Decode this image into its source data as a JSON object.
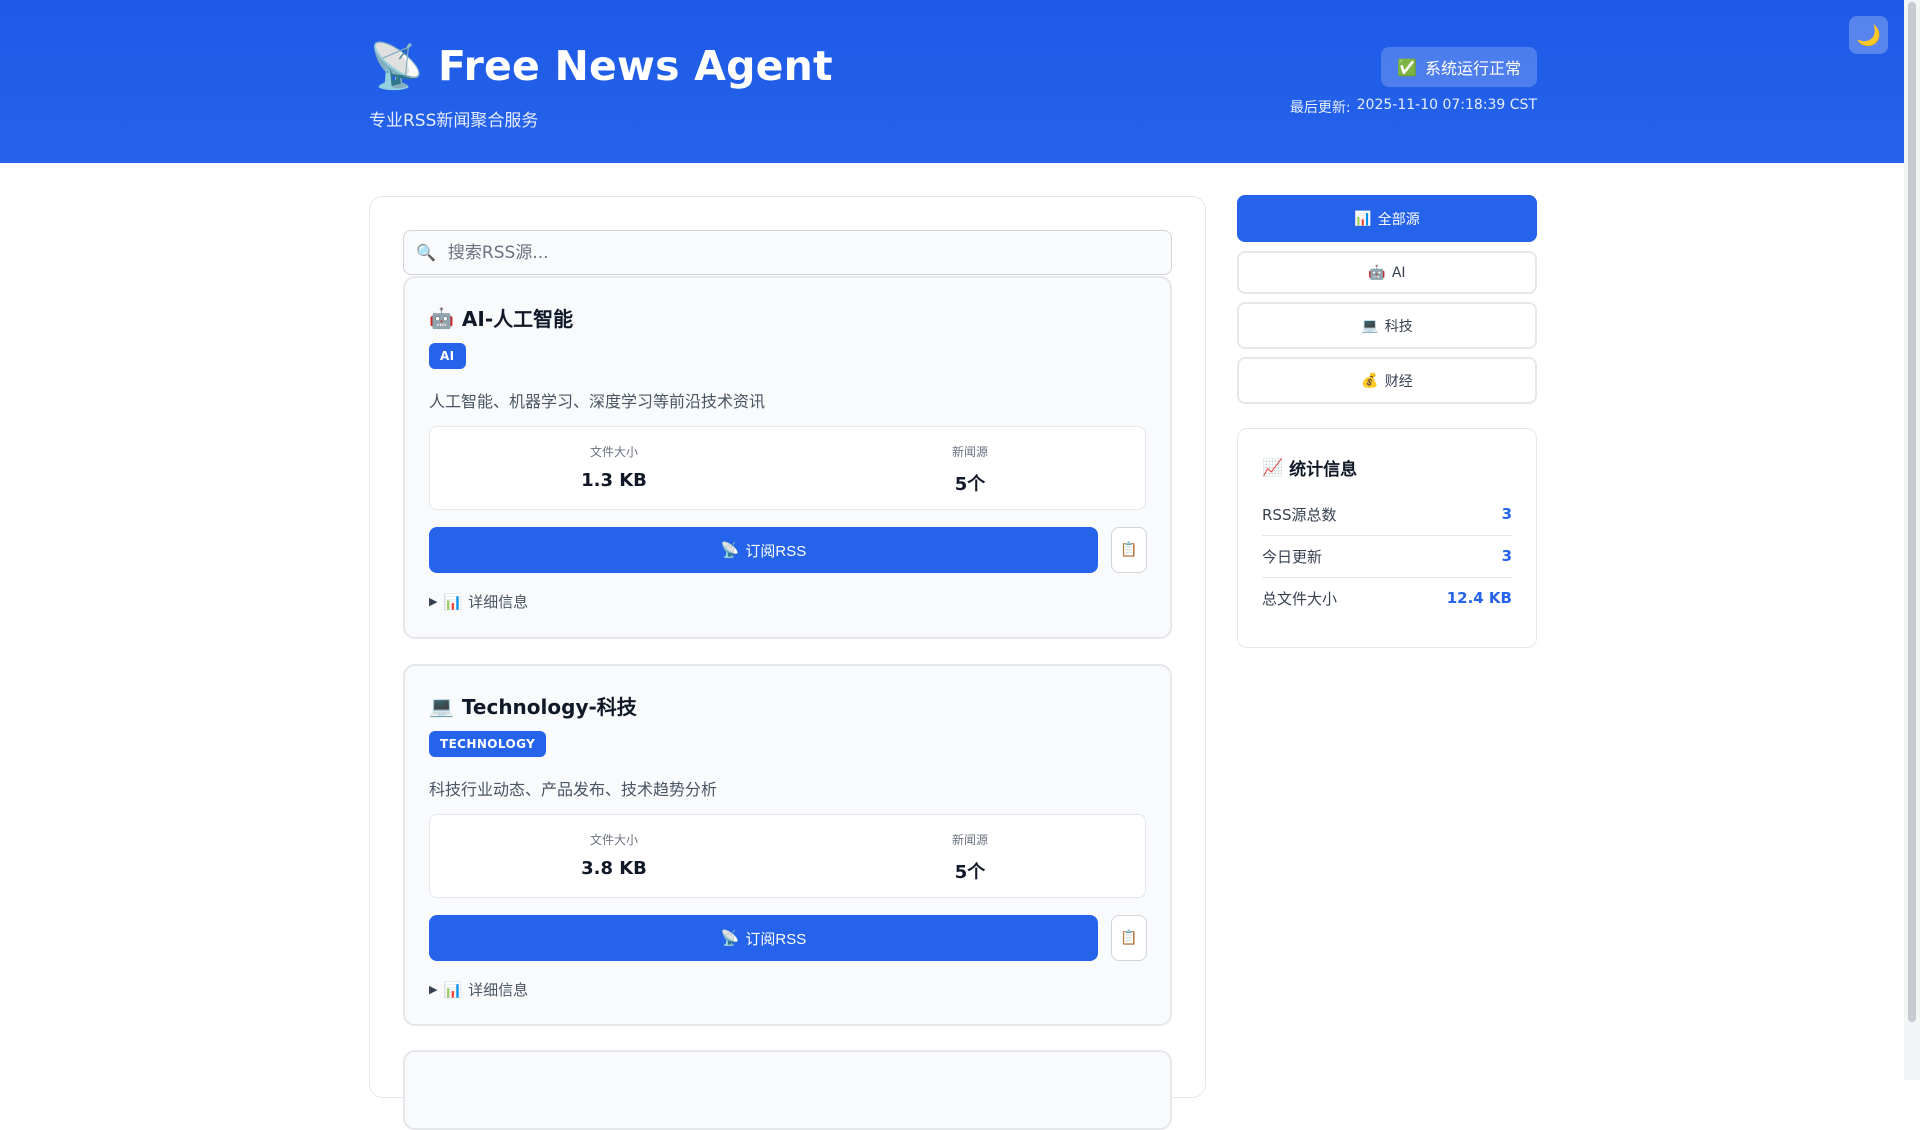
{
  "header": {
    "title_icon": "📡",
    "title": "Free News Agent",
    "subtitle": "专业RSS新闻聚合服务",
    "status_icon": "✅",
    "status": "系统运行正常",
    "last_updated_label": "最后更新:",
    "last_updated_value": "2025-11-10 07:18:39 CST",
    "theme_toggle_icon": "🌙"
  },
  "search": {
    "icon": "🔍",
    "placeholder": "搜索RSS源..."
  },
  "cards": [
    {
      "icon": "🤖",
      "title": "AI-人工智能",
      "tag": "AI",
      "description": "人工智能、机器学习、深度学习等前沿技术资讯",
      "file_size_label": "文件大小",
      "file_size": "1.3 KB",
      "sources_label": "新闻源",
      "sources": "5个",
      "subscribe_icon": "📡",
      "subscribe_label": "订阅RSS",
      "copy_icon": "📋",
      "details_icon": "📊",
      "details_label": "详细信息"
    },
    {
      "icon": "💻",
      "title": "Technology-科技",
      "tag": "TECHNOLOGY",
      "description": "科技行业动态、产品发布、技术趋势分析",
      "file_size_label": "文件大小",
      "file_size": "3.8 KB",
      "sources_label": "新闻源",
      "sources": "5个",
      "subscribe_icon": "📡",
      "subscribe_label": "订阅RSS",
      "copy_icon": "📋",
      "details_icon": "📊",
      "details_label": "详细信息"
    }
  ],
  "filters": [
    {
      "icon": "📊",
      "label": "全部源",
      "active": true
    },
    {
      "icon": "🤖",
      "label": "AI",
      "active": false
    },
    {
      "icon": "💻",
      "label": "科技",
      "active": false
    },
    {
      "icon": "💰",
      "label": "财经",
      "active": false
    }
  ],
  "stats": {
    "icon": "📈",
    "title": "统计信息",
    "rows": [
      {
        "label": "RSS源总数",
        "value": "3"
      },
      {
        "label": "今日更新",
        "value": "3"
      },
      {
        "label": "总文件大小",
        "value": "12.4 KB"
      }
    ]
  },
  "colors": {
    "primary": "#2563eb",
    "border": "#e5e7eb"
  }
}
